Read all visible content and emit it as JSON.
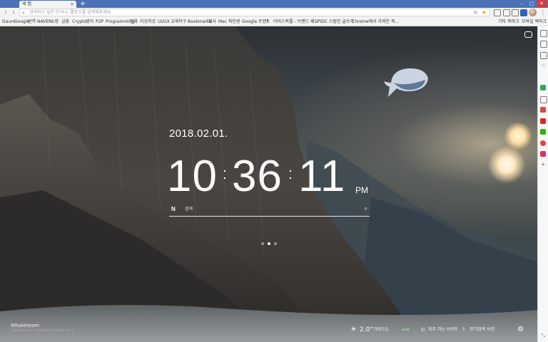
{
  "tab": {
    "title": "새 탭",
    "close": "×",
    "new_tab": "+"
  },
  "window_buttons": [
    "–",
    "▢",
    "✕"
  ],
  "toolbar": {
    "back": "‹",
    "forward": "›",
    "address_placeholder": "검색하고 싶은 단어나, 웹주소를 입력해주세요.",
    "reload": "↻",
    "bookmark_star": "★",
    "menu": "⋮"
  },
  "bookmarks": [
    "Daum",
    "Google",
    "번역",
    "NAVER",
    "쇼핑",
    "금융",
    "Crypto",
    "영어",
    "P2P",
    "Programming",
    "전화",
    "이것저것",
    "UI/UX 교육",
    "작구",
    "Bookmarks",
    "회사",
    "Mac",
    "파인셩",
    "Google 트렌드",
    "f",
    "아이스픽를 - 브랜드 패...",
    "SPIDC 스팀인 글쓰기",
    "Chrome에서 가져온 북..."
  ],
  "bookmarks_right": [
    "기타 북마크",
    "모바일 북마크"
  ],
  "newtab": {
    "date": "2018.02.01.",
    "clock": {
      "hours": "10",
      "minutes": "36",
      "seconds": "11",
      "ampm": "PM"
    },
    "search": {
      "logo": "N",
      "label": "검색",
      "icon": "⌕"
    },
    "pages_total": 3,
    "page_active": 2,
    "brand_title": "Whaleteam",
    "brand_sub": "Double suns / planet in a dark land",
    "weather": {
      "icon": "☀",
      "temp": "2.0°",
      "desc": "가이드도"
    },
    "links": {
      "frequent": "자주 가는 사이트",
      "trending": "인기검색 사건",
      "trending_count": "1"
    },
    "settings_icon": "⚙"
  },
  "colors": {
    "tabstrip": "#4a72b5",
    "accent": "#2f62b8",
    "star": "#f0a21f"
  },
  "side_panel_icons": [
    "zoom-icon",
    "note-icon",
    "pocket-icon",
    "star-icon",
    "calendar-icon",
    "clipboard-icon",
    "youtube-icon",
    "line-icon",
    "record-icon",
    "music-icon",
    "add-icon"
  ]
}
